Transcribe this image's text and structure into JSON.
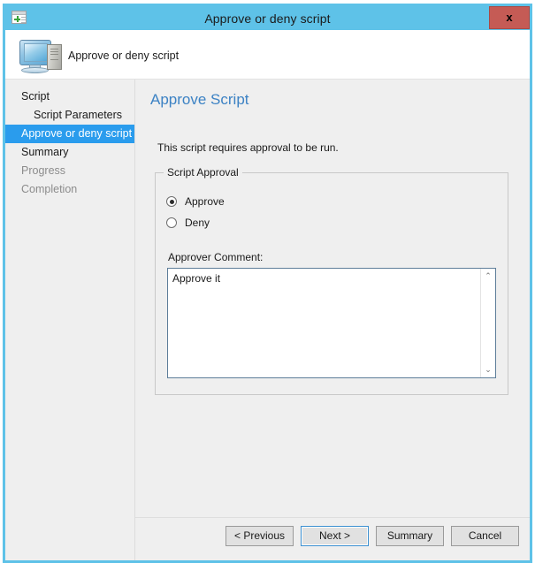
{
  "window": {
    "title": "Approve or deny script",
    "close_label": "x",
    "icon": "window-plus-icon"
  },
  "header": {
    "title": "Approve or deny script",
    "icon": "computer-icon"
  },
  "sidebar": {
    "items": [
      {
        "label": "Script",
        "state": "normal",
        "indent": false
      },
      {
        "label": "Script Parameters",
        "state": "normal",
        "indent": true
      },
      {
        "label": "Approve or deny script",
        "state": "active",
        "indent": false
      },
      {
        "label": "Summary",
        "state": "normal",
        "indent": false
      },
      {
        "label": "Progress",
        "state": "dim",
        "indent": false
      },
      {
        "label": "Completion",
        "state": "dim",
        "indent": false
      }
    ]
  },
  "main": {
    "heading": "Approve Script",
    "description": "This script requires approval to be run.",
    "group": {
      "legend": "Script Approval",
      "options": [
        {
          "label": "Approve",
          "selected": true
        },
        {
          "label": "Deny",
          "selected": false
        }
      ],
      "comment_label": "Approver Comment:",
      "comment_value": "Approve it",
      "scroll_up_glyph": "⌃",
      "scroll_down_glyph": "⌄"
    }
  },
  "footer": {
    "buttons": [
      {
        "label": "< Previous",
        "focused": false
      },
      {
        "label": "Next >",
        "focused": true
      },
      {
        "label": "Summary",
        "focused": false
      },
      {
        "label": "Cancel",
        "focused": false
      }
    ]
  },
  "colors": {
    "titlebar": "#5ec2e8",
    "close_button": "#c55b55",
    "accent_heading": "#3c82c4",
    "nav_active": "#2a9ced",
    "panel_bg": "#efefef"
  }
}
